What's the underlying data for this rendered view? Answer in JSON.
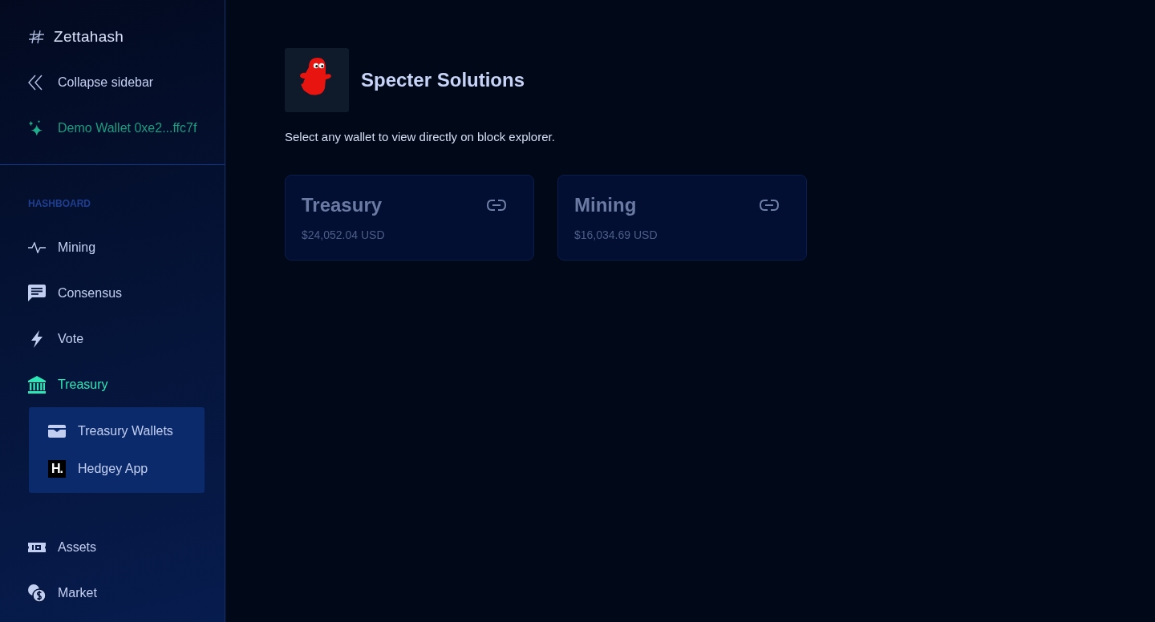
{
  "sidebar": {
    "brand": "Zettahash",
    "collapse": "Collapse sidebar",
    "wallet": "Demo Wallet 0xe2...ffc7f",
    "section": "HASHBOARD",
    "items": [
      {
        "label": "Mining",
        "selected": false
      },
      {
        "label": "Consensus",
        "selected": false
      },
      {
        "label": "Vote",
        "selected": false
      },
      {
        "label": "Treasury",
        "selected": true,
        "children": [
          {
            "label": "Treasury Wallets"
          },
          {
            "label": "Hedgey App",
            "badge": "H."
          }
        ]
      },
      {
        "label": "Assets",
        "selected": false
      },
      {
        "label": "Market",
        "selected": false
      }
    ]
  },
  "main": {
    "org": "Specter Solutions",
    "instruction": "Select any wallet to view directly on block explorer.",
    "wallets": [
      {
        "name": "Treasury",
        "balance": "$24,052.04 USD"
      },
      {
        "name": "Mining",
        "balance": "$16,034.69 USD"
      }
    ]
  }
}
